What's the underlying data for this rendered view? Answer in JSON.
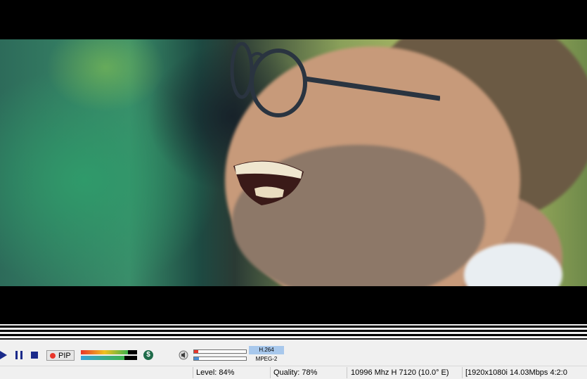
{
  "video": {
    "description_icon": "video-frame"
  },
  "toolbar": {
    "pip_label": "PIP",
    "signal_symbol": "$",
    "video_codec": "H.264",
    "audio_codec": "MPEG-2",
    "level_fill": 0.84,
    "quality_fill": 0.78,
    "volume_fill": 0.08,
    "balance_fill": 0.1
  },
  "status": {
    "level": "Level: 84%",
    "quality": "Quality: 78%",
    "transponder": "10996 Mhz  H  7120  (10.0° E)",
    "stream_info": "[1920x1080i  14.03Mbps 4:2:0"
  },
  "colors": {
    "level_gradient": [
      "#e8352a",
      "#f0c020",
      "#3cb14a"
    ],
    "quality_gradient": [
      "#3aa3d9",
      "#3cb14a"
    ],
    "accent_blue": "#a8c8ec"
  }
}
